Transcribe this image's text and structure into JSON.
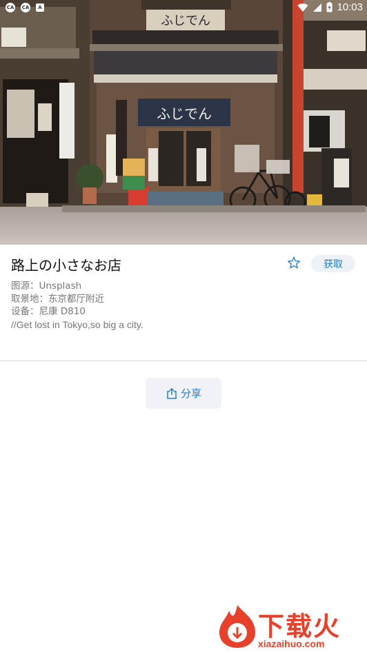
{
  "status_bar": {
    "time": "10:03",
    "icons": [
      "ca-icon",
      "ca-icon",
      "a-icon",
      "wifi-icon",
      "signal-icon",
      "battery-icon"
    ],
    "notif_labels": [
      "CA",
      "CA",
      "A"
    ]
  },
  "photo": {
    "title": "路上の小さなお店",
    "source": "图源：Unsplash",
    "location": "取景地：东京都厅附近",
    "device": "设备：尼康 D810",
    "quote": "//Get lost in Tokyo,so big a city.",
    "sign_main": "ふじでん",
    "favorite_icon": "star-outline-icon",
    "get_label": "获取"
  },
  "share": {
    "label": "分享",
    "icon": "share-icon"
  },
  "watermark": {
    "text": "下载火",
    "url": "xiazaihuo.com"
  },
  "colors": {
    "accent": "#1e80cf",
    "button_bg": "#eef1f6",
    "watermark": "#e8412b"
  }
}
